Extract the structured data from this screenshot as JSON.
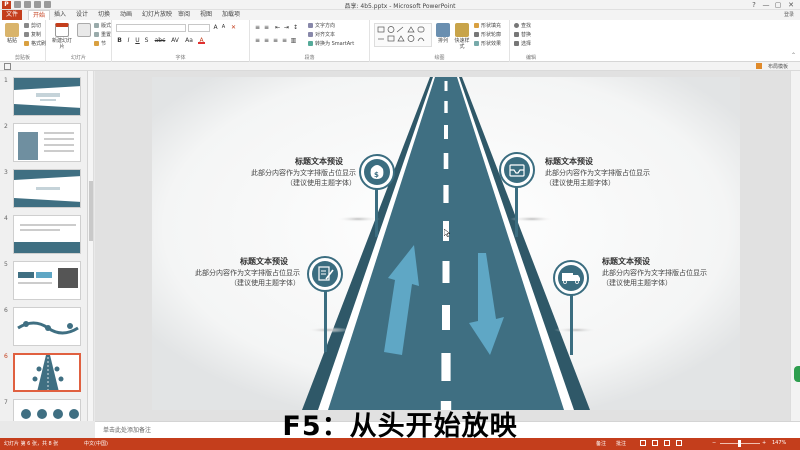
{
  "window": {
    "title": "品享: 4b5.pptx - Microsoft PowerPoint",
    "app_icon": "P",
    "controls": [
      "?",
      "—",
      "▢",
      "✕"
    ]
  },
  "tabs": [
    "文件",
    "开始",
    "插入",
    "设计",
    "切换",
    "动画",
    "幻灯片放映",
    "审阅",
    "视图",
    "加载项"
  ],
  "active_tab": "开始",
  "signin_label": "登录",
  "ribbon": {
    "clipboard": {
      "label": "剪贴板",
      "paste": "粘贴",
      "cut": "剪切",
      "copy": "复制",
      "format_painter": "格式刷"
    },
    "slides": {
      "label": "幻灯片",
      "new_slide": "新建幻灯片",
      "layout": "版式",
      "reset": "重置",
      "section": "节"
    },
    "font": {
      "label": "字体",
      "font_name": "",
      "font_size": "",
      "buttons": [
        "B",
        "I",
        "U",
        "S",
        "abc",
        "AV",
        "Aa",
        "A"
      ]
    },
    "paragraph": {
      "label": "段落",
      "text_direction": "文字方向",
      "align_text": "对齐文本",
      "smartart": "转换为 SmartArt"
    },
    "drawing": {
      "label": "绘图",
      "arrange": "排列",
      "quick_styles": "快速样式",
      "shape_fill": "形状填充",
      "shape_outline": "形状轮廓",
      "shape_effects": "形状效果"
    },
    "editing": {
      "label": "编辑",
      "find": "查找",
      "replace": "替换",
      "select": "选择"
    }
  },
  "strip": {
    "left_icon": "layout-icon",
    "right_label": "布局模板"
  },
  "thumbnails": {
    "numbers": [
      "1",
      "2",
      "3",
      "4",
      "5",
      "6",
      "7",
      "8"
    ],
    "selected": "6"
  },
  "slide": {
    "items": [
      {
        "title": "标题文本预设",
        "desc": "此部分内容作为文字排版占位显示（建议使用主题字体）",
        "icon": "money-bag-icon"
      },
      {
        "title": "标题文本预设",
        "desc": "此部分内容作为文字排版占位显示（建议使用主题字体）",
        "icon": "inbox-icon"
      },
      {
        "title": "标题文本预设",
        "desc": "此部分内容作为文字排版占位显示（建议使用主题字体）",
        "icon": "edit-document-icon"
      },
      {
        "title": "标题文本预设",
        "desc": "此部分内容作为文字排版占位显示（建议使用主题字体）",
        "icon": "truck-icon"
      }
    ],
    "colors": {
      "road": "#3f6f82",
      "road_dark": "#2f5868",
      "arrow": "#5fa7c5",
      "icon_circle": "#3b6d80",
      "pole": "#4a8aa3"
    }
  },
  "notes_placeholder": "单击此处添加备注",
  "status": {
    "slide_info": "幻灯片 第 6 张，共 8 张",
    "language": "中文(中国)",
    "notes_btn": "备注",
    "comments_btn": "批注",
    "zoom": "147%"
  },
  "caption": "F5：从头开始放映"
}
